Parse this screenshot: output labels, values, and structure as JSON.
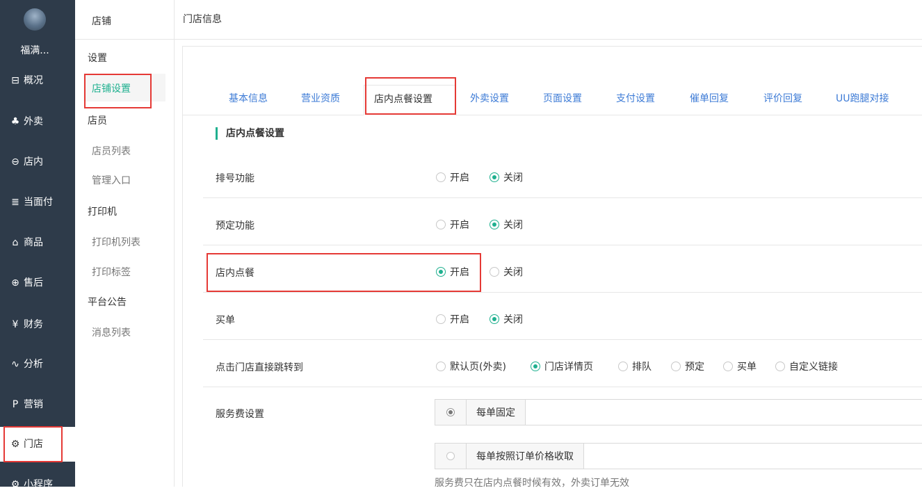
{
  "nav": {
    "store_name": "福满...",
    "items": [
      {
        "icon": "overview-icon",
        "glyph": "⊟",
        "label": "概况"
      },
      {
        "icon": "takeout-icon",
        "glyph": "♣",
        "label": "外卖"
      },
      {
        "icon": "dine-in-icon",
        "glyph": "⊖",
        "label": "店内"
      },
      {
        "icon": "pay-icon",
        "glyph": "≣",
        "label": "当面付"
      },
      {
        "icon": "goods-icon",
        "glyph": "⌂",
        "label": "商品"
      },
      {
        "icon": "after-sale-icon",
        "glyph": "⊕",
        "label": "售后"
      },
      {
        "icon": "finance-icon",
        "glyph": "¥",
        "label": "财务"
      },
      {
        "icon": "analysis-icon",
        "glyph": "∿",
        "label": "分析"
      },
      {
        "icon": "marketing-icon",
        "glyph": "P",
        "label": "营销"
      },
      {
        "icon": "store-gear-icon",
        "glyph": "⚙",
        "label": "门店"
      },
      {
        "icon": "miniapp-gear-icon",
        "glyph": "⚙",
        "label": "小程序"
      }
    ]
  },
  "subnav": {
    "title": "店铺",
    "groups": [
      {
        "label": "设置"
      },
      {
        "label": "店员"
      },
      {
        "label": "打印机"
      },
      {
        "label": "平台公告"
      }
    ],
    "items": [
      {
        "label": "店铺设置"
      },
      {
        "label": "店员列表"
      },
      {
        "label": "管理入口"
      },
      {
        "label": "打印机列表"
      },
      {
        "label": "打印标签"
      },
      {
        "label": "消息列表"
      }
    ]
  },
  "header": {
    "title": "门店信息"
  },
  "tabs": [
    "基本信息",
    "营业资质",
    "店内点餐设置",
    "外卖设置",
    "页面设置",
    "支付设置",
    "催单回复",
    "评价回复",
    "UU跑腿对接"
  ],
  "section_title": "店内点餐设置",
  "rows": {
    "queue": {
      "label": "排号功能",
      "opt_on": "开启",
      "opt_off": "关闭",
      "selected": "关闭"
    },
    "reserve": {
      "label": "预定功能",
      "opt_on": "开启",
      "opt_off": "关闭",
      "selected": "关闭"
    },
    "dine_in": {
      "label": "店内点餐",
      "opt_on": "开启",
      "opt_off": "关闭",
      "selected": "开启"
    },
    "pay_bill": {
      "label": "买单",
      "opt_on": "开启",
      "opt_off": "关闭",
      "selected": "关闭"
    },
    "jump": {
      "label": "点击门店直接跳转到",
      "options": [
        "默认页(外卖)",
        "门店详情页",
        "排队",
        "预定",
        "买单",
        "自定义链接"
      ],
      "selected": "门店详情页"
    },
    "service_fee": {
      "label": "服务费设置",
      "fixed_label": "每单固定",
      "by_price_label": "每单按照订单价格收取",
      "fixed_value": "",
      "by_price_value": "",
      "note": "服务费只在店内点餐时候有效，外卖订单无效"
    }
  },
  "colors": {
    "accent": "#1fb08f",
    "link": "#3d7bd6",
    "nav_bg": "#2e3b4a",
    "highlight": "#e53935"
  }
}
